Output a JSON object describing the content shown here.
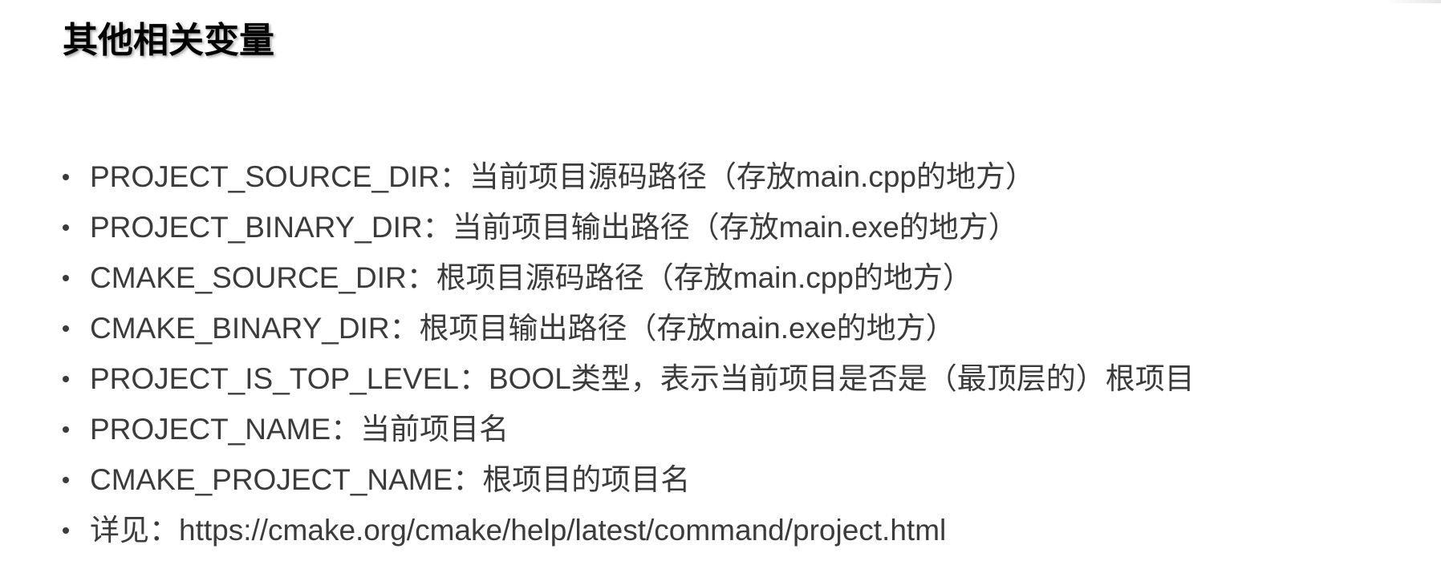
{
  "slide": {
    "title": "其他相关变量",
    "items": [
      {
        "text": "PROJECT_SOURCE_DIR：当前项目源码路径（存放main.cpp的地方）"
      },
      {
        "text": "PROJECT_BINARY_DIR：当前项目输出路径（存放main.exe的地方）"
      },
      {
        "text": "CMAKE_SOURCE_DIR：根项目源码路径（存放main.cpp的地方）"
      },
      {
        "text": "CMAKE_BINARY_DIR：根项目输出路径（存放main.exe的地方）"
      },
      {
        "text": "PROJECT_IS_TOP_LEVEL：BOOL类型，表示当前项目是否是（最顶层的）根项目"
      },
      {
        "text": "PROJECT_NAME：当前项目名"
      },
      {
        "text": "CMAKE_PROJECT_NAME：根项目的项目名"
      },
      {
        "text": "详见：https://cmake.org/cmake/help/latest/command/project.html"
      }
    ]
  },
  "colors": {
    "title": "#000000",
    "body_text": "#3b3b3b",
    "background": "#ffffff"
  }
}
